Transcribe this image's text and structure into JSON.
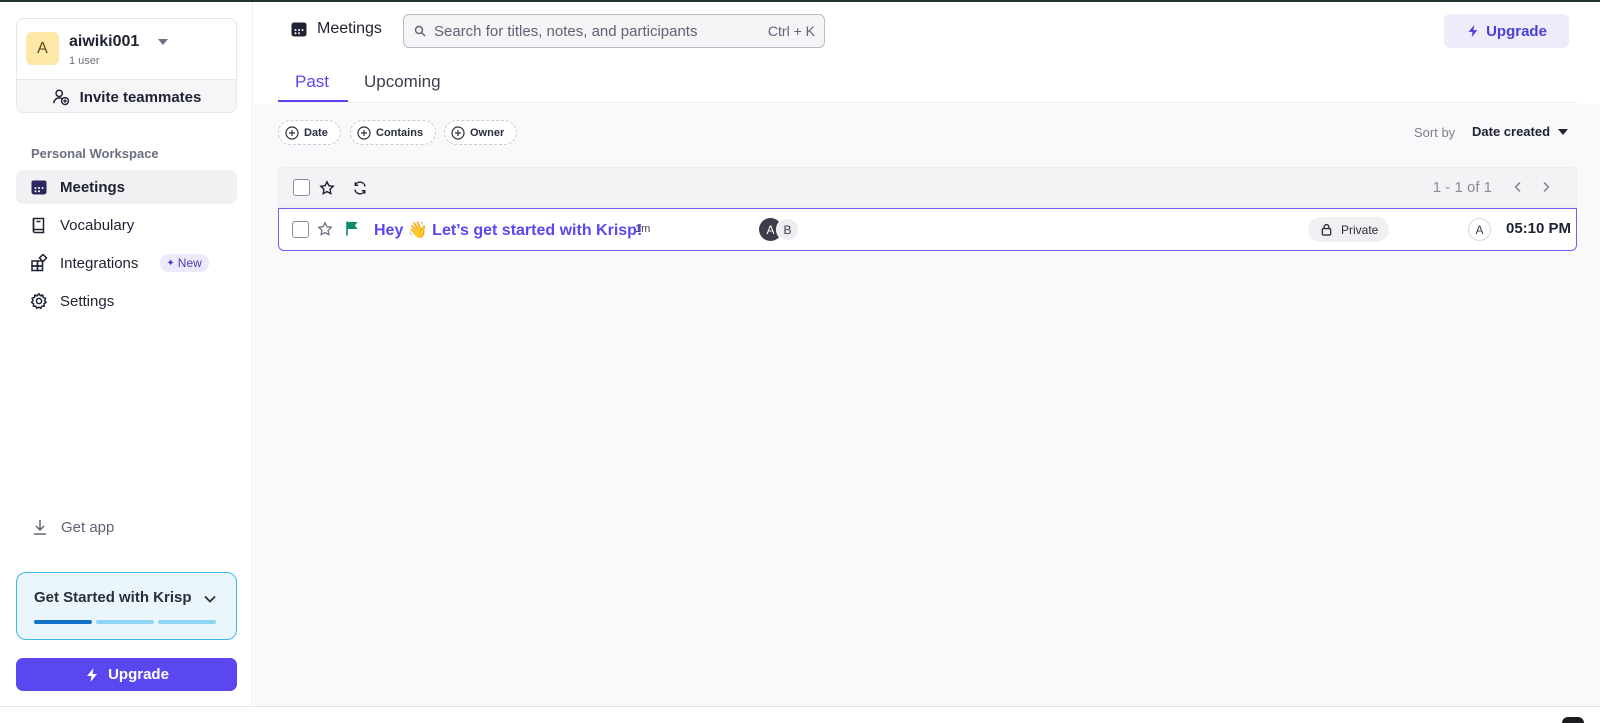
{
  "account": {
    "avatar_letter": "A",
    "name": "aiwiki001",
    "subtitle": "1 user",
    "invite_label": "Invite teammates"
  },
  "sidebar": {
    "section_label": "Personal Workspace",
    "items": [
      {
        "label": "Meetings",
        "icon": "calendar-icon",
        "active": true
      },
      {
        "label": "Vocabulary",
        "icon": "book-icon"
      },
      {
        "label": "Integrations",
        "icon": "integrations-icon",
        "badge": "New"
      },
      {
        "label": "Settings",
        "icon": "gear-icon"
      }
    ],
    "get_app_label": "Get app",
    "get_started": {
      "title": "Get Started with Krisp",
      "progress_steps_total": 3,
      "progress_steps_done": 1
    },
    "upgrade_label": "Upgrade"
  },
  "header": {
    "title": "Meetings",
    "search_placeholder": "Search for titles, notes, and participants",
    "search_shortcut": "Ctrl + K",
    "upgrade_label": "Upgrade"
  },
  "tabs": [
    {
      "label": "Past",
      "active": true
    },
    {
      "label": "Upcoming"
    }
  ],
  "filters": [
    {
      "label": "Date"
    },
    {
      "label": "Contains"
    },
    {
      "label": "Owner"
    }
  ],
  "sort": {
    "label": "Sort by",
    "value": "Date created"
  },
  "list": {
    "pagination": "1 - 1 of 1",
    "meetings": [
      {
        "title": "Hey 👋 Let’s get started with Krisp!",
        "age": "1m",
        "participants": [
          "A",
          "B"
        ],
        "privacy": "Private",
        "owner": "A",
        "time": "05:10 PM"
      }
    ]
  },
  "colors": {
    "accent": "#5b47f0",
    "flag": "#0f8a6a",
    "progress_filled": "#1273c9",
    "progress_empty": "#8fd4f2"
  }
}
